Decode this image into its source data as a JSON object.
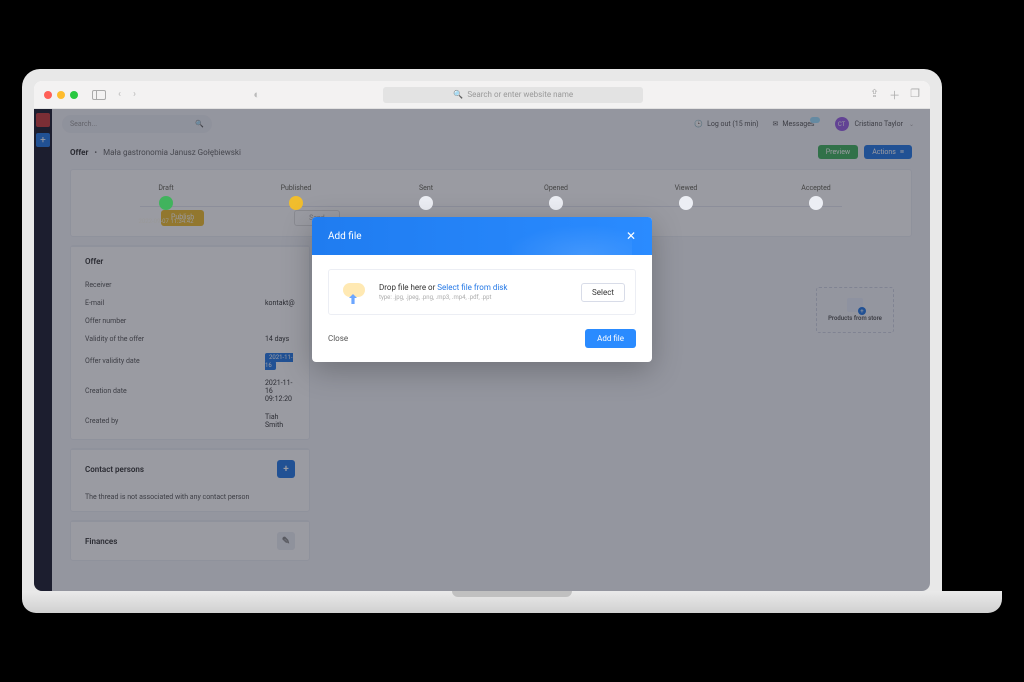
{
  "browser": {
    "address_placeholder": "Search or enter website name"
  },
  "topbar": {
    "search_placeholder": "Search...",
    "logout": "Log out (15 min)",
    "messages": "Messages",
    "user_name": "Cristiano Taylor",
    "user_initials": "CT"
  },
  "breadcrumb": {
    "root": "Offer",
    "current": "Mała gastronomia Janusz Gołębiewski",
    "preview": "Preview",
    "actions": "Actions"
  },
  "stepper": {
    "steps": [
      "Draft",
      "Published",
      "Sent",
      "Opened",
      "Viewed",
      "Accepted"
    ],
    "draft_timestamp": "2022-09-07 11:34:42",
    "publish_btn": "Publish",
    "send_btn": "Send"
  },
  "offer": {
    "title": "Offer",
    "rows": {
      "receiver_k": "Receiver",
      "receiver_v": "",
      "email_k": "E-mail",
      "email_v": "kontakt@",
      "number_k": "Offer number",
      "number_v": "",
      "validity_k": "Validity of the offer",
      "validity_v": "14 days",
      "validdate_k": "Offer validity date",
      "validdate_v": "2021-11-16",
      "creation_k": "Creation date",
      "creation_v": "2021-11-16 09:12:20",
      "createdby_k": "Created by",
      "createdby_v": "Tiah Smith"
    }
  },
  "contacts": {
    "title": "Contact persons",
    "empty": "The thread is not associated with any contact person"
  },
  "finances": {
    "title": "Finances"
  },
  "store_box": "Products from store",
  "modal": {
    "title": "Add file",
    "drop_prefix": "Drop file here or",
    "drop_link": "Select file from disk",
    "types": "type: .jpg, .jpeg, .png, .mp3, .mp4, .pdf, .ppt",
    "select": "Select",
    "close": "Close",
    "add": "Add file"
  }
}
